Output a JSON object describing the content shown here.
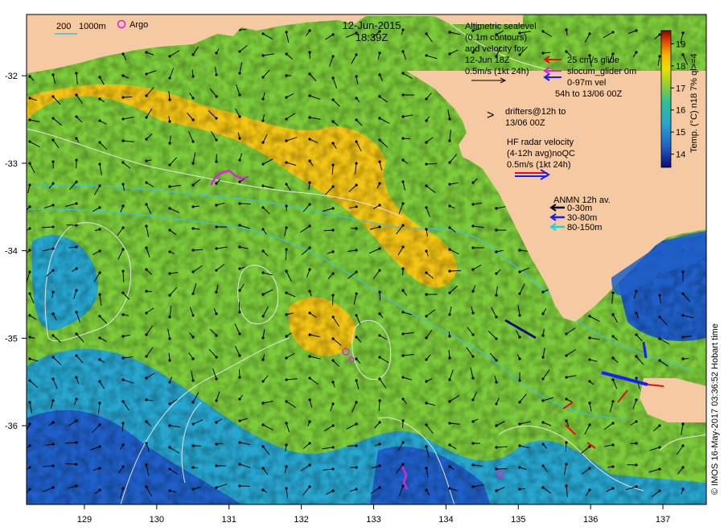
{
  "colors": {
    "land": "#f5c9a1",
    "ocean_warm": "#f2c414",
    "ocean_mid": "#7ccb3a",
    "ocean_cool": "#27a6cf",
    "ocean_deep": "#1f5fc8",
    "contour": "#e6e6e6",
    "isobath": "#3fc2d8",
    "argo": "#e020e0"
  },
  "header": {
    "date": "12-Jun-2015",
    "time": "18:39Z"
  },
  "scale_legend": {
    "isobath_200": "200",
    "isobath_1000": "1000m",
    "argo_label": "Argo"
  },
  "legend": {
    "altimetry": [
      "Altimetric sealevel",
      "(0.1m contours)",
      "and velocity for",
      "12-Jun 18Z",
      "0.5m/s (1kt 24h)"
    ],
    "glider_velocity": "25 cm/s glide",
    "glider_name": "slocum_glider 0m",
    "glider_depth": "0-97m vel",
    "glider_window": "54h to 13/06 00Z",
    "drifters": [
      "drifters@12h to",
      "13/06 00Z"
    ],
    "drifter_symbol": ">",
    "hf_radar": [
      "HF radar velocity",
      "(4-12h avg)noQC",
      "0.5m/s (1kt 24h)"
    ],
    "anmn": {
      "title": "ANMN 12h av.",
      "bins": [
        {
          "label": "0-30m",
          "color": "#000000"
        },
        {
          "label": "30-80m",
          "color": "#1a1aff"
        },
        {
          "label": "80-150m",
          "color": "#19d6d6"
        }
      ]
    }
  },
  "colorbar": {
    "title": "Temp. (°C) n18 7% ql>=4",
    "ticks": [
      "19",
      "18",
      "17",
      "16",
      "15",
      "14"
    ],
    "range": [
      13.4,
      19.6
    ]
  },
  "credit": "© IMOS 16-May-2017 03:36:52 Hobart time",
  "axes": {
    "x_ticks": [
      "129",
      "130",
      "131",
      "132",
      "133",
      "134",
      "135",
      "136",
      "137"
    ],
    "y_ticks": [
      "-32",
      "-33",
      "-34",
      "-35",
      "-36"
    ],
    "lon_range": [
      128.2,
      137.6
    ],
    "lat_range": [
      -31.3,
      -36.9
    ]
  }
}
